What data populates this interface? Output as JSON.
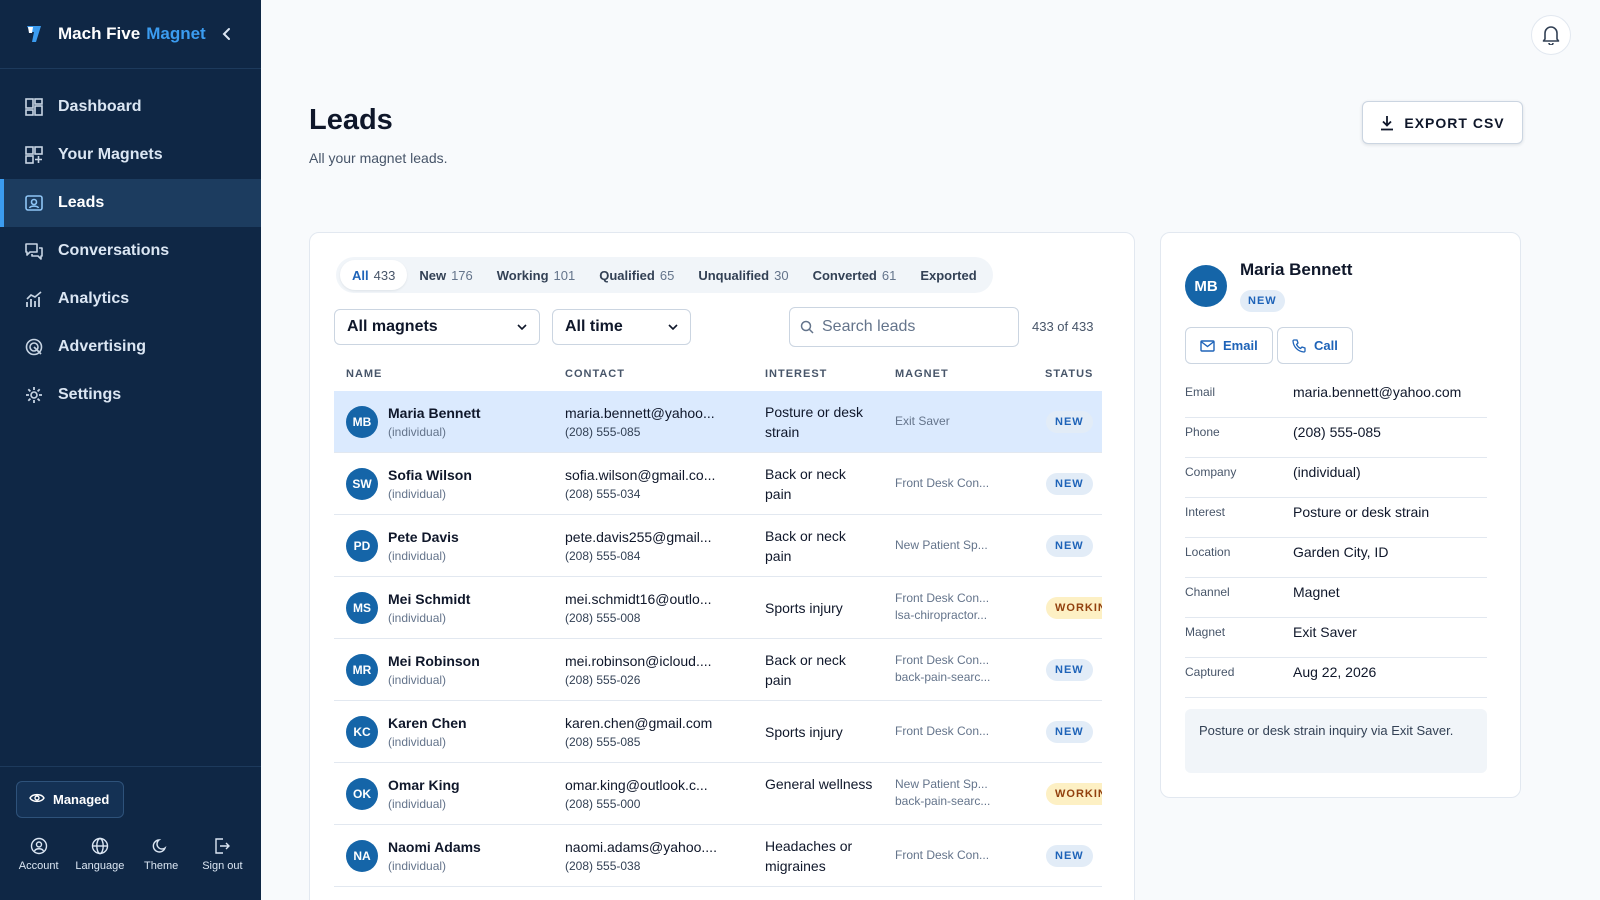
{
  "app": {
    "brand": "Mach Five",
    "brand_accent": "Magnet"
  },
  "sidebar": {
    "items": [
      {
        "label": "Dashboard",
        "icon": "dashboard-icon"
      },
      {
        "label": "Your Magnets",
        "icon": "magnets-icon"
      },
      {
        "label": "Leads",
        "icon": "leads-icon",
        "active": true
      },
      {
        "label": "Conversations",
        "icon": "conversations-icon"
      },
      {
        "label": "Analytics",
        "icon": "analytics-icon"
      },
      {
        "label": "Advertising",
        "icon": "advertising-icon"
      },
      {
        "label": "Settings",
        "icon": "settings-icon"
      }
    ],
    "managed_label": "Managed",
    "bottom_actions": [
      {
        "label": "Account",
        "icon": "account-icon"
      },
      {
        "label": "Language",
        "icon": "globe-icon"
      },
      {
        "label": "Theme",
        "icon": "moon-icon"
      },
      {
        "label": "Sign out",
        "icon": "sign-out-icon"
      }
    ]
  },
  "header": {
    "title": "Leads",
    "subtitle": "All your magnet leads.",
    "export_label": "EXPORT CSV"
  },
  "tabs": [
    {
      "label": "All",
      "count": "433",
      "active": true
    },
    {
      "label": "New",
      "count": "176"
    },
    {
      "label": "Working",
      "count": "101"
    },
    {
      "label": "Qualified",
      "count": "65"
    },
    {
      "label": "Unqualified",
      "count": "30"
    },
    {
      "label": "Converted",
      "count": "61"
    },
    {
      "label": "Exported",
      "count": ""
    }
  ],
  "filters": {
    "magnet_value": "All magnets",
    "time_value": "All time",
    "search_placeholder": "Search leads",
    "result_count": "433 of 433"
  },
  "table": {
    "columns": [
      "NAME",
      "CONTACT",
      "INTEREST",
      "MAGNET",
      "STATUS"
    ],
    "rows": [
      {
        "initials": "MB",
        "name": "Maria Bennett",
        "company": "(individual)",
        "email": "maria.bennett@yahoo...",
        "phone": "(208) 555-085",
        "interest": "Posture or desk strain",
        "magnet1": "Exit Saver",
        "magnet2": "",
        "status": "NEW",
        "selected": true
      },
      {
        "initials": "SW",
        "name": "Sofia Wilson",
        "company": "(individual)",
        "email": "sofia.wilson@gmail.co...",
        "phone": "(208) 555-034",
        "interest": "Back or neck pain",
        "magnet1": "Front Desk Con...",
        "magnet2": "",
        "status": "NEW"
      },
      {
        "initials": "PD",
        "name": "Pete Davis",
        "company": "(individual)",
        "email": "pete.davis255@gmail...",
        "phone": "(208) 555-084",
        "interest": "Back or neck pain",
        "magnet1": "New Patient Sp...",
        "magnet2": "",
        "status": "NEW"
      },
      {
        "initials": "MS",
        "name": "Mei Schmidt",
        "company": "(individual)",
        "email": "mei.schmidt16@outlo...",
        "phone": "(208) 555-008",
        "interest": "Sports injury",
        "magnet1": "Front Desk Con...",
        "magnet2": "lsa-chiropractor...",
        "status": "WORKIN"
      },
      {
        "initials": "MR",
        "name": "Mei Robinson",
        "company": "(individual)",
        "email": "mei.robinson@icloud....",
        "phone": "(208) 555-026",
        "interest": "Back or neck pain",
        "magnet1": "Front Desk Con...",
        "magnet2": "back-pain-searc...",
        "status": "NEW"
      },
      {
        "initials": "KC",
        "name": "Karen Chen",
        "company": "(individual)",
        "email": "karen.chen@gmail.com",
        "phone": "(208) 555-085",
        "interest": "Sports injury",
        "magnet1": "Front Desk Con...",
        "magnet2": "",
        "status": "NEW"
      },
      {
        "initials": "OK",
        "name": "Omar King",
        "company": "(individual)",
        "email": "omar.king@outlook.c...",
        "phone": "(208) 555-000",
        "interest": "General wellness",
        "magnet1": "New Patient Sp...",
        "magnet2": "back-pain-searc...",
        "status": "WORKIN"
      },
      {
        "initials": "NA",
        "name": "Naomi Adams",
        "company": "(individual)",
        "email": "naomi.adams@yahoo....",
        "phone": "(208) 555-038",
        "interest": "Headaches or migraines",
        "magnet1": "Front Desk Con...",
        "magnet2": "",
        "status": "NEW"
      }
    ]
  },
  "detail": {
    "initials": "MB",
    "name": "Maria Bennett",
    "status": "NEW",
    "email_button": "Email",
    "call_button": "Call",
    "fields": [
      {
        "label": "Email",
        "value": "maria.bennett@yahoo.com"
      },
      {
        "label": "Phone",
        "value": "(208) 555-085"
      },
      {
        "label": "Company",
        "value": "(individual)"
      },
      {
        "label": "Interest",
        "value": "Posture or desk strain"
      },
      {
        "label": "Location",
        "value": "Garden City, ID"
      },
      {
        "label": "Channel",
        "value": "Magnet"
      },
      {
        "label": "Magnet",
        "value": "Exit Saver"
      },
      {
        "label": "Captured",
        "value": "Aug 22, 2026"
      }
    ],
    "note": "Posture or desk strain inquiry via Exit Saver."
  },
  "colors": {
    "sidebar_bg": "#0f2745",
    "accent": "#3b9cf0",
    "avatar": "#1565a8",
    "status_new_bg": "#e2ecf7",
    "status_working_bg": "#fdf0c4"
  }
}
